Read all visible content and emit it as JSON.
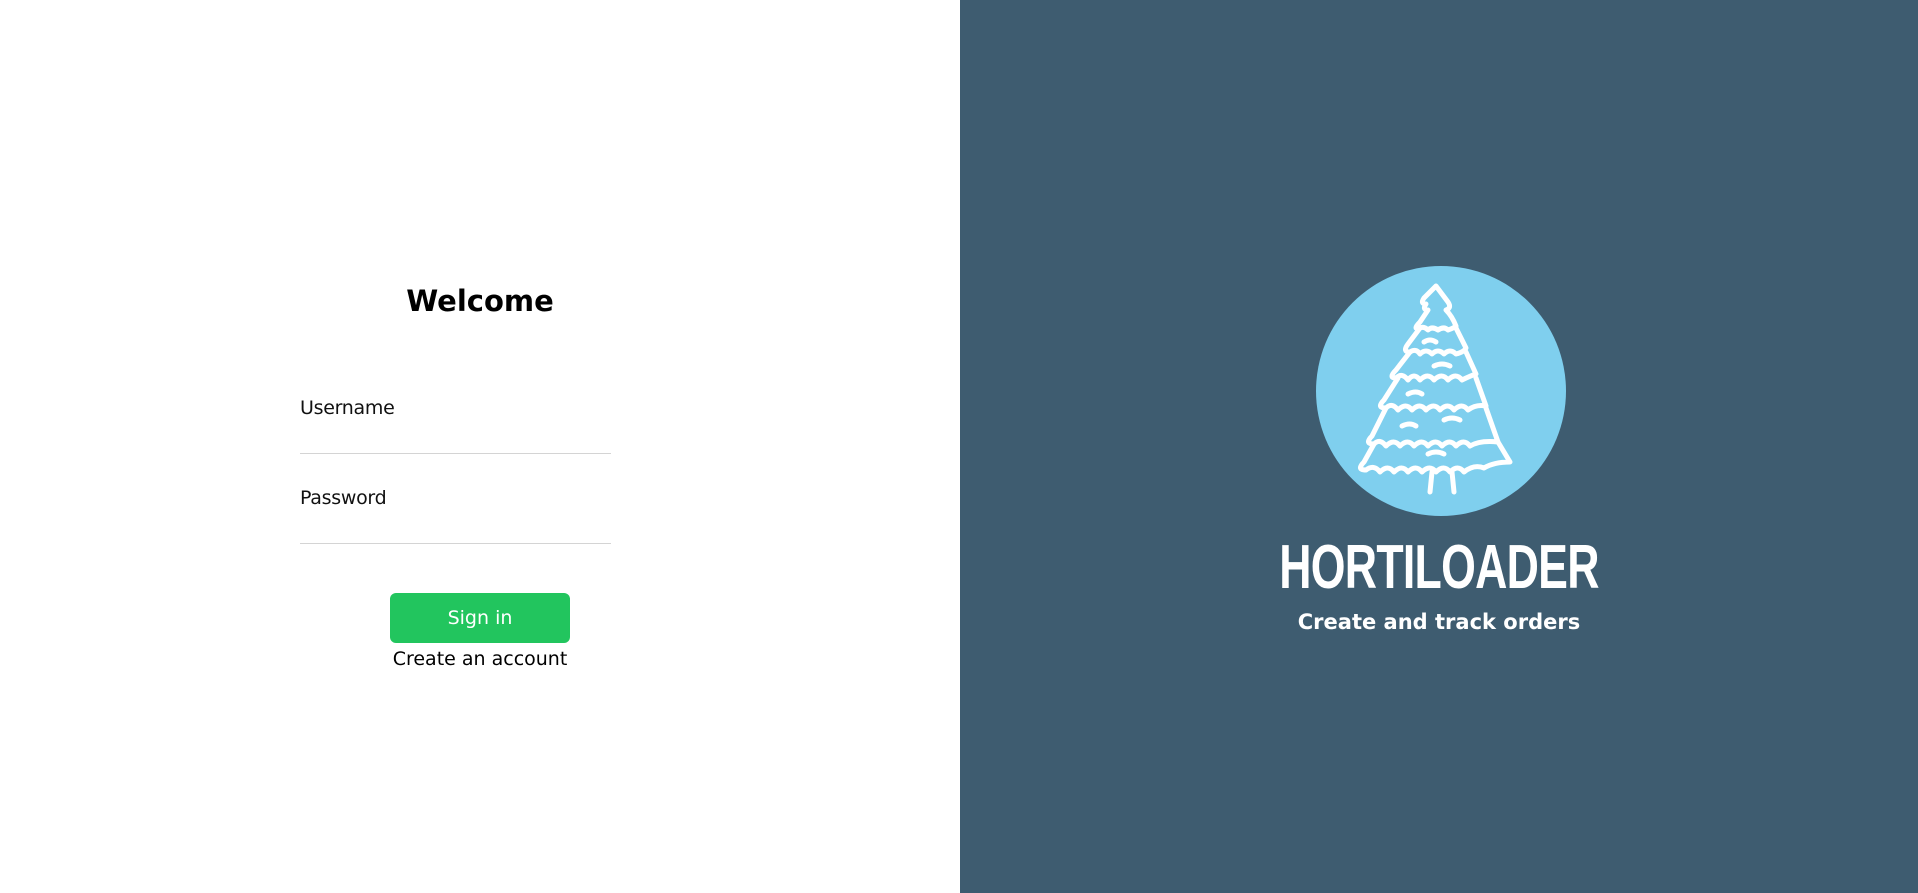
{
  "login": {
    "title": "Welcome",
    "username_label": "Username",
    "username_value": "",
    "password_label": "Password",
    "password_value": "",
    "signin_label": "Sign in",
    "create_account_label": "Create an account"
  },
  "brand": {
    "name": "HORTILOADER",
    "tagline": "Create and track orders",
    "logo_icon": "pine-tree-icon"
  },
  "colors": {
    "left_background": "#ffffff",
    "right_background": "#3e5c70",
    "logo_circle": "#7fcfee",
    "signin_button": "#22c55e",
    "brand_text": "#ffffff"
  }
}
